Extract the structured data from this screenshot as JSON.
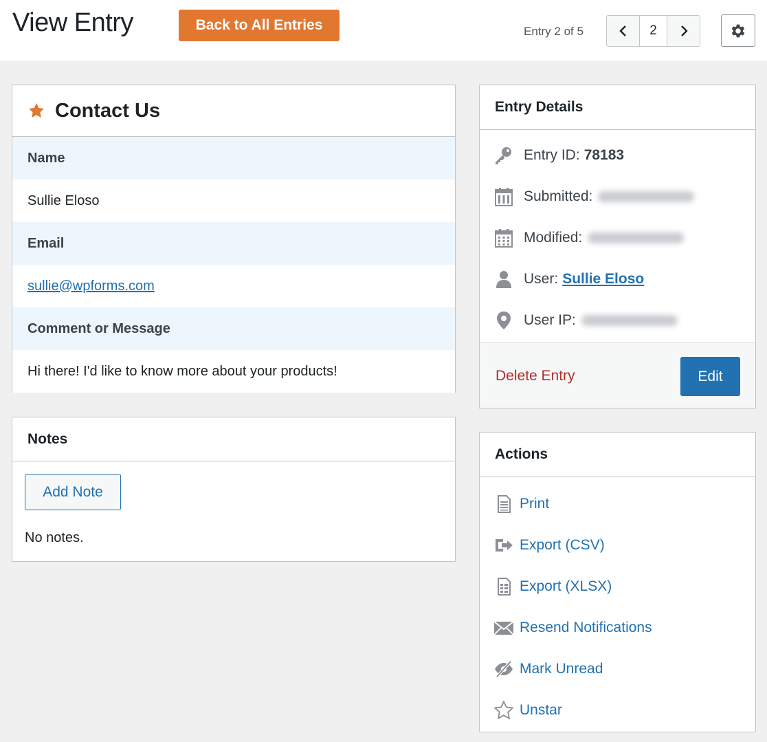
{
  "header": {
    "title": "View Entry",
    "back_label": "Back to All Entries",
    "entry_count": "Entry 2 of 5",
    "page_number": "2",
    "prev_icon": "chevron-left-icon",
    "next_icon": "chevron-right-icon",
    "settings_icon": "gear-icon"
  },
  "form": {
    "title": "Contact Us",
    "star_icon": "star-filled-icon",
    "star_color": "#e27730",
    "fields": [
      {
        "label": "Name",
        "value": "Sullie Eloso"
      },
      {
        "label": "Email",
        "value": "sullie@wpforms.com"
      },
      {
        "label": "Comment or Message",
        "value": "Hi there! I'd like to know more about your products!"
      }
    ]
  },
  "notes": {
    "title": "Notes",
    "add_label": "Add Note",
    "empty_text": "No notes."
  },
  "details": {
    "title": "Entry Details",
    "entry_id_label": "Entry ID:",
    "entry_id": "78183",
    "submitted_label": "Submitted:",
    "modified_label": "Modified:",
    "user_label": "User:",
    "user_name": "Sullie Eloso",
    "ip_label": "User IP:",
    "delete_label": "Delete Entry",
    "edit_label": "Edit"
  },
  "actions": {
    "title": "Actions",
    "items": [
      {
        "label": "Print",
        "icon": "print-icon"
      },
      {
        "label": "Export (CSV)",
        "icon": "export-icon"
      },
      {
        "label": "Export (XLSX)",
        "icon": "spreadsheet-icon"
      },
      {
        "label": "Resend Notifications",
        "icon": "envelope-icon"
      },
      {
        "label": "Mark Unread",
        "icon": "eye-slash-icon"
      },
      {
        "label": "Unstar",
        "icon": "star-outline-icon"
      }
    ]
  },
  "colors": {
    "accent_orange": "#e27730",
    "link_blue": "#2271b1",
    "delete_red": "#b32d2e",
    "label_bg": "#edf5fd"
  }
}
